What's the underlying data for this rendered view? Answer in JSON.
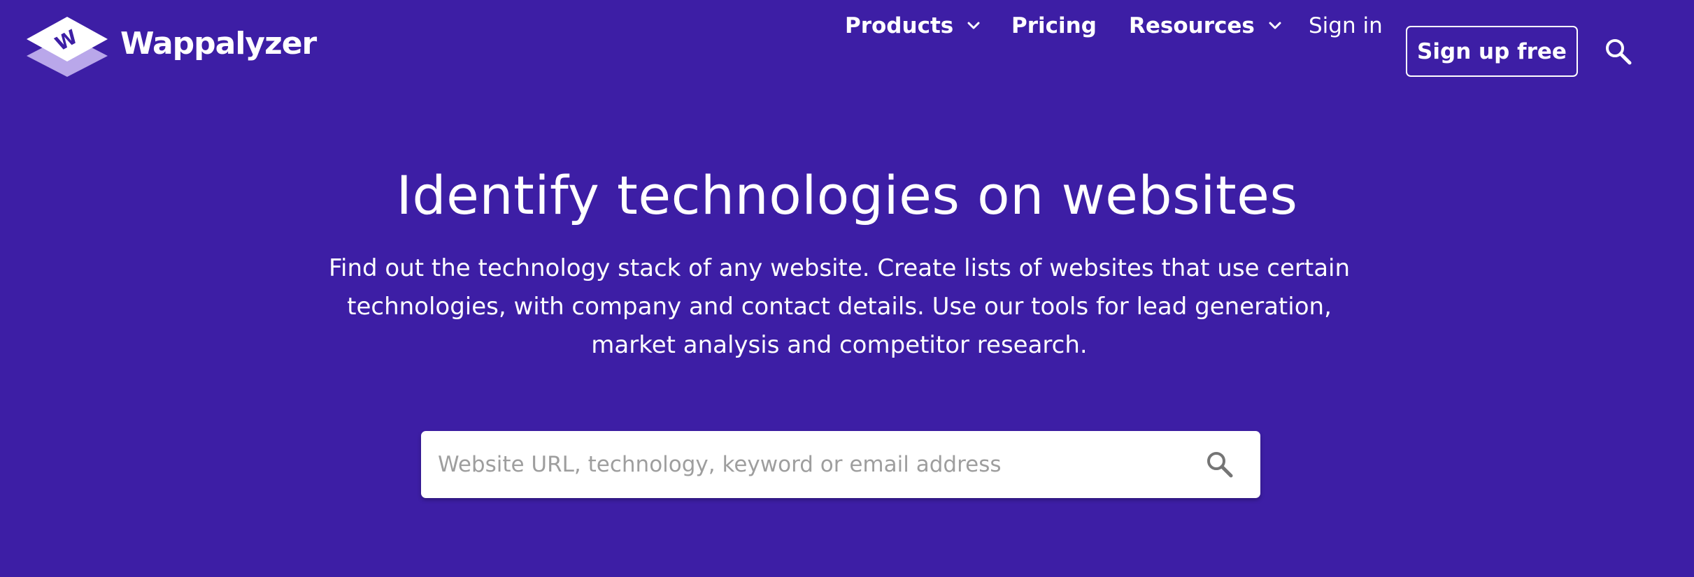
{
  "brand": {
    "name": "Wappalyzer",
    "logo_letter": "W",
    "colors": {
      "background": "#3d1ea5",
      "logo_front": "#ffffff",
      "logo_back": "#b9a7ea",
      "text": "#ffffff"
    }
  },
  "nav": {
    "products_label": "Products",
    "pricing_label": "Pricing",
    "resources_label": "Resources",
    "signin_label": "Sign in",
    "signup_label": "Sign up free",
    "search_icon": "search-icon"
  },
  "hero": {
    "title": "Identify technologies on websites",
    "description": "Find out the technology stack of any website. Create lists of websites that use certain technologies, with company and contact details. Use our tools for lead generation, market analysis and competitor research."
  },
  "search": {
    "placeholder": "Website URL, technology, keyword or email address",
    "value": "",
    "icon": "search-icon"
  }
}
